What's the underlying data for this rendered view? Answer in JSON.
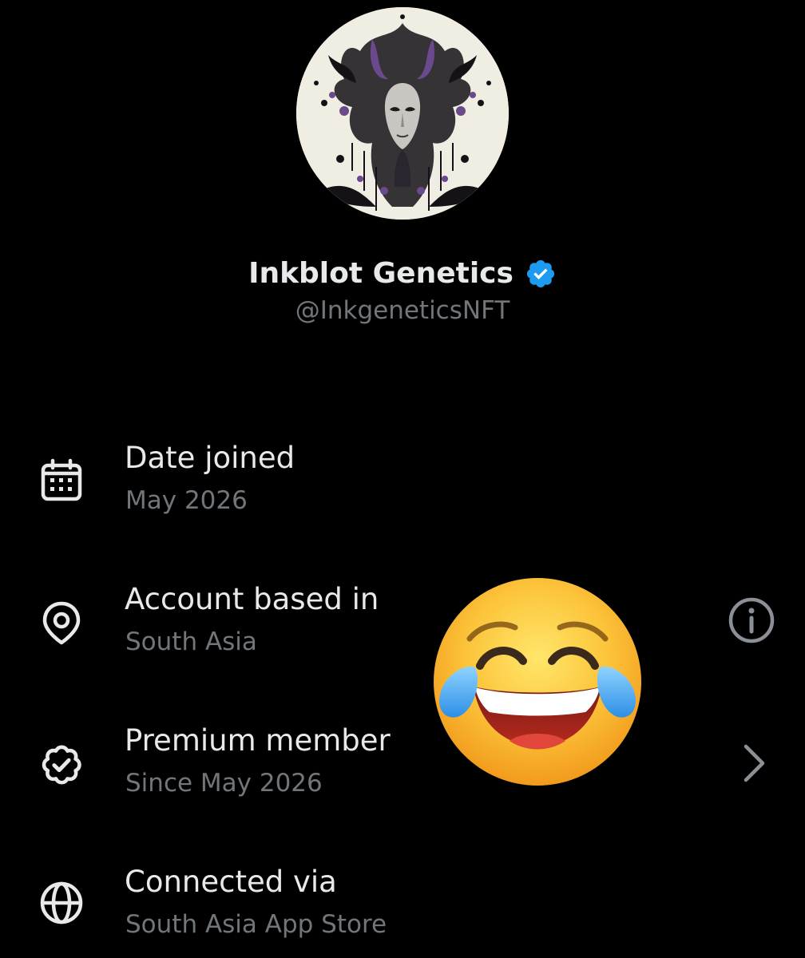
{
  "profile": {
    "display_name": "Inkblot Genetics",
    "handle": "@InkgeneticsNFT",
    "avatar_icon": "inkblot-portrait-avatar",
    "verified_icon": "verified-badge-icon",
    "verified_color": "#1d9bf0"
  },
  "details": [
    {
      "title": "Date joined",
      "value": "May 2026",
      "icon": "calendar-icon"
    },
    {
      "title": "Account based in",
      "value": "South Asia",
      "icon": "location-pin-icon",
      "action_icon": "info-icon"
    },
    {
      "title": "Premium member",
      "value": "Since May 2026",
      "icon": "verified-check-icon",
      "action_icon": "chevron-right-icon"
    },
    {
      "title": "Connected via",
      "value": "South Asia App Store",
      "icon": "globe-icon"
    }
  ],
  "overlay": {
    "emoji": "face-with-tears-of-joy"
  },
  "colors": {
    "background": "#000000",
    "primary_text": "#e7e9ea",
    "secondary_text": "#71767b",
    "accent": "#1d9bf0"
  }
}
